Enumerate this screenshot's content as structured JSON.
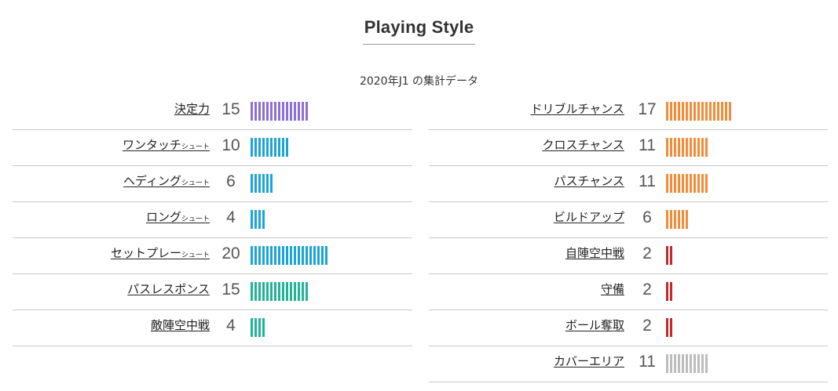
{
  "title": "Playing Style",
  "subtitle": "2020年J1 の集計データ",
  "colors": {
    "purple": "#8e6fd6",
    "blue": "#1aa5d6",
    "teal": "#20b496",
    "orange": "#f28c38",
    "red": "#c62828",
    "gray": "#bdbdbd"
  },
  "chart_data": {
    "type": "bar",
    "title": "Playing Style",
    "subtitle": "2020年J1 の集計データ",
    "left": [
      {
        "label": "決定力",
        "suffix": "",
        "value": 15,
        "color": "purple"
      },
      {
        "label": "ワンタッチ",
        "suffix": "シュート",
        "value": 10,
        "color": "blue"
      },
      {
        "label": "ヘディング",
        "suffix": "シュート",
        "value": 6,
        "color": "blue"
      },
      {
        "label": "ロング",
        "suffix": "シュート",
        "value": 4,
        "color": "blue"
      },
      {
        "label": "セットプレー",
        "suffix": "シュート",
        "value": 20,
        "color": "blue"
      },
      {
        "label": "パスレスポンス",
        "suffix": "",
        "value": 15,
        "color": "teal"
      },
      {
        "label": "敵陣空中戦",
        "suffix": "",
        "value": 4,
        "color": "teal"
      }
    ],
    "right": [
      {
        "label": "ドリブルチャンス",
        "suffix": "",
        "value": 17,
        "color": "orange"
      },
      {
        "label": "クロスチャンス",
        "suffix": "",
        "value": 11,
        "color": "orange"
      },
      {
        "label": "パスチャンス",
        "suffix": "",
        "value": 11,
        "color": "orange"
      },
      {
        "label": "ビルドアップ",
        "suffix": "",
        "value": 6,
        "color": "orange"
      },
      {
        "label": "自陣空中戦",
        "suffix": "",
        "value": 2,
        "color": "red"
      },
      {
        "label": "守備",
        "suffix": "",
        "value": 2,
        "color": "red"
      },
      {
        "label": "ボール奪取",
        "suffix": "",
        "value": 2,
        "color": "red"
      },
      {
        "label": "カバーエリア",
        "suffix": "",
        "value": 11,
        "color": "gray"
      }
    ]
  }
}
